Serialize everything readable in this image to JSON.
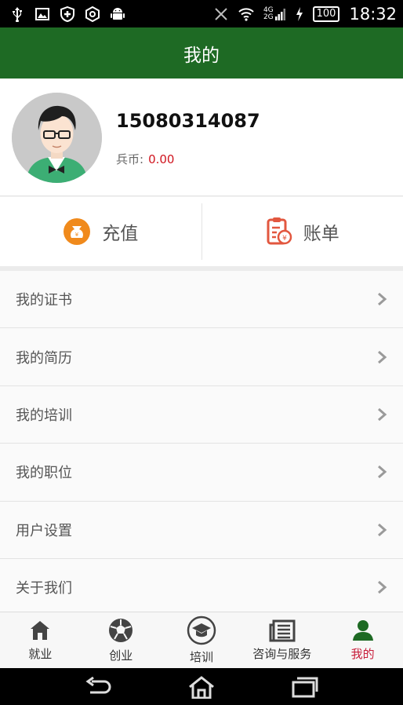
{
  "status_bar": {
    "time": "18:32",
    "battery": "100",
    "network_top": "4G",
    "network_bottom": "2G"
  },
  "header": {
    "title": "我的"
  },
  "profile": {
    "phone": "15080314087",
    "coin_label": "兵币:",
    "coin_value": "0.00"
  },
  "actions": [
    {
      "label": "充值",
      "icon": "money-bag-icon"
    },
    {
      "label": "账单",
      "icon": "bill-icon"
    }
  ],
  "menu": [
    {
      "label": "我的证书"
    },
    {
      "label": "我的简历"
    },
    {
      "label": "我的培训"
    },
    {
      "label": "我的职位"
    },
    {
      "label": "用户设置"
    },
    {
      "label": "关于我们"
    }
  ],
  "tabs": [
    {
      "label": "就业",
      "icon": "building-icon"
    },
    {
      "label": "创业",
      "icon": "soccer-ball-icon"
    },
    {
      "label": "培训",
      "icon": "graduation-cap-icon"
    },
    {
      "label": "咨询与服务",
      "icon": "newspaper-icon"
    },
    {
      "label": "我的",
      "icon": "user-icon",
      "active": true
    }
  ],
  "colors": {
    "header": "#1e6a24",
    "coin_value": "#d0141e",
    "active_tab": "#c81d3a",
    "action_orange": "#f08a1c",
    "action_red": "#e2573f"
  }
}
